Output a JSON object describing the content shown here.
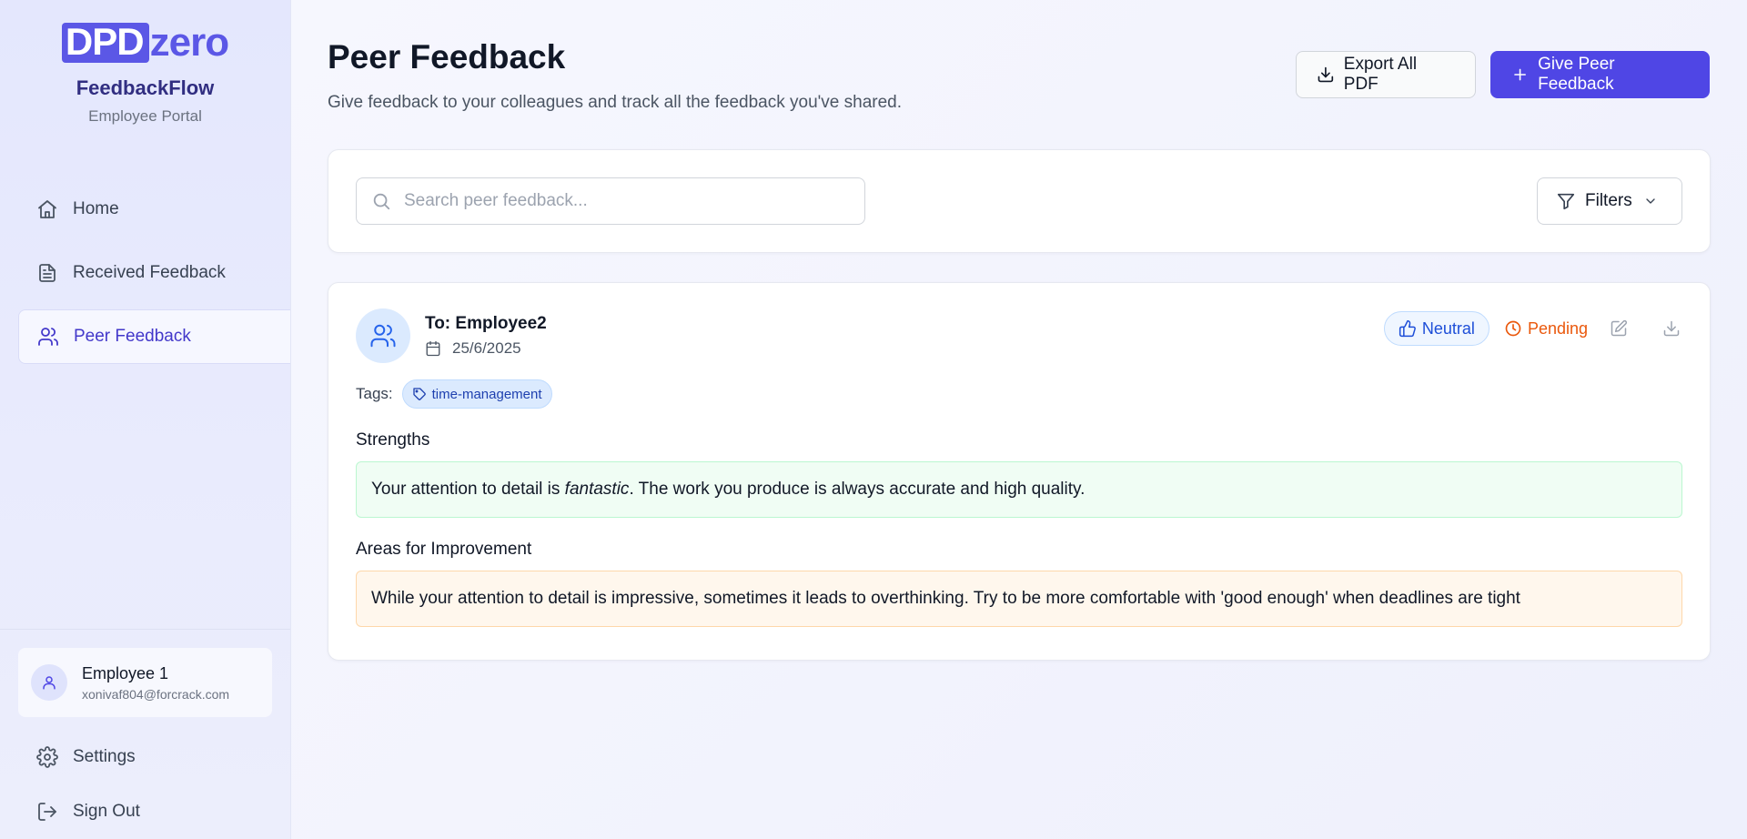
{
  "brand": {
    "logo_text": "DPDzero",
    "logo_dpd": "DPD",
    "logo_zero": "zero",
    "app_name": "FeedbackFlow",
    "portal_label": "Employee Portal",
    "accent_color": "#5b57e6"
  },
  "sidebar": {
    "items": [
      {
        "label": "Home",
        "icon": "home-icon",
        "active": false
      },
      {
        "label": "Received Feedback",
        "icon": "document-icon",
        "active": false
      },
      {
        "label": "Peer Feedback",
        "icon": "users-icon",
        "active": true
      }
    ],
    "user": {
      "name": "Employee 1",
      "email": "xonivaf804@forcrack.com",
      "icon": "user-icon"
    },
    "settings_label": "Settings",
    "signout_label": "Sign Out"
  },
  "header": {
    "title": "Peer Feedback",
    "subtitle": "Give feedback to your colleagues and track all the feedback you've shared.",
    "export_label": "Export All PDF",
    "give_label": "Give Peer Feedback"
  },
  "search": {
    "placeholder": "Search peer feedback...",
    "value": "",
    "filters_label": "Filters"
  },
  "feedback": [
    {
      "to": "To: Employee2",
      "date": "25/6/2025",
      "sentiment": "Neutral",
      "status": "Pending",
      "tags_label": "Tags:",
      "tags": [
        "time-management"
      ],
      "strengths_label": "Strengths",
      "strengths_before": "Your attention to detail is ",
      "strengths_em": "fantastic",
      "strengths_after": ". The work you produce is always accurate and high quality.",
      "improvement_label": "Areas for Improvement",
      "improvement": "While your attention to detail is impressive, sometimes it leads to overthinking. Try to be more comfortable with 'good enough' when deadlines are tight"
    }
  ],
  "colors": {
    "primary": "#4f46e5",
    "neutral_badge": "#1d4ed8",
    "pending": "#ea580c",
    "strengths_bg": "#f0fdf4",
    "improvement_bg": "#fff7ed"
  }
}
